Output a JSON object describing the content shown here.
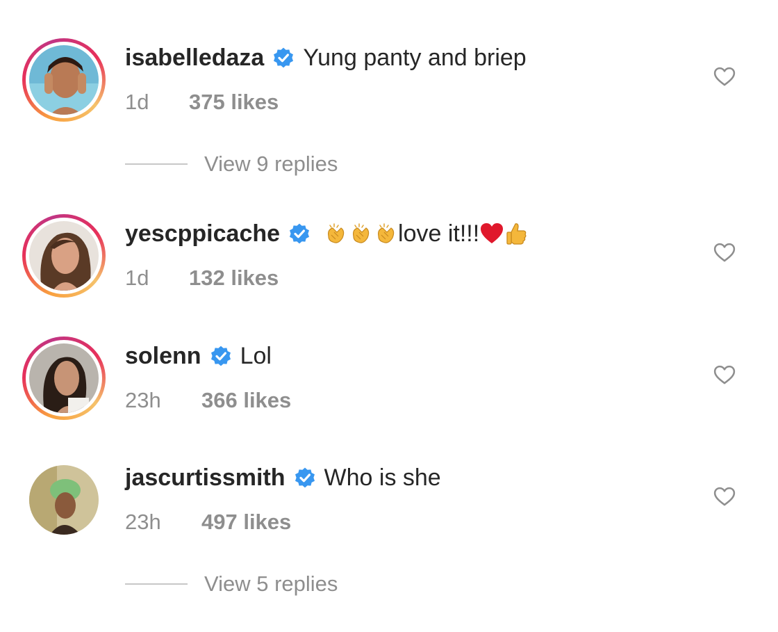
{
  "comments": [
    {
      "username": "isabelledaza",
      "text": "Yung panty and briep",
      "time": "1d",
      "likes": "375 likes",
      "avatar_ring": "story",
      "replies": "View 9 replies"
    },
    {
      "username": "yescppicache",
      "text_prefix_emoji": [
        "clapping-hands-emoji",
        "clapping-hands-emoji",
        "clapping-hands-emoji"
      ],
      "text": "love it!!!",
      "text_suffix_emoji": [
        "red-heart-emoji",
        "thumbs-up-emoji"
      ],
      "time": "1d",
      "likes": "132 likes",
      "avatar_ring": "story"
    },
    {
      "username": "solenn",
      "text": "Lol",
      "time": "23h",
      "likes": "366 likes",
      "avatar_ring": "story"
    },
    {
      "username": "jascurtissmith",
      "text": "Who is she",
      "time": "23h",
      "likes": "497 likes",
      "avatar_ring": "none",
      "replies": "View 5 replies"
    }
  ],
  "icons": {
    "verified": "verified-badge-icon",
    "like": "heart-outline-icon"
  },
  "colors": {
    "verified_blue": "#3897f0",
    "text_primary": "#262626",
    "text_secondary": "#8e8e8e"
  }
}
